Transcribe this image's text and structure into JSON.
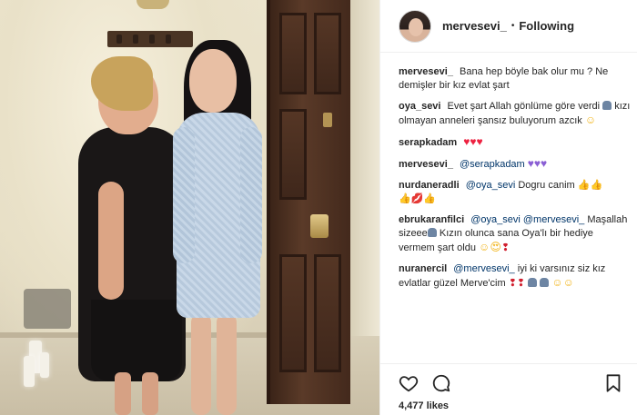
{
  "post": {
    "username": "mervesevi_",
    "follow_separator": "•",
    "follow_status": "Following",
    "likes_text": "4,477 likes"
  },
  "comments": {
    "c1": {
      "user": "mervesevi_",
      "text": "Bana hep böyle bak olur mu ? Ne demişler bir kız evlat şart"
    },
    "c2": {
      "user": "oya_sevi",
      "text1": "Evet şart Allah gönlüme göre verdi",
      "text2": "kızı olmayan anneleri şansız buluyorum azcık"
    },
    "c3": {
      "user": "serapkadam"
    },
    "c4": {
      "user": "mervesevi_",
      "mention": "@serapkadam"
    },
    "c5": {
      "user": "nurdaneradli",
      "mention": "@oya_sevi",
      "text": "Dogru canim"
    },
    "c6": {
      "user": "ebrukaranfilci",
      "mention1": "@oya_sevi",
      "mention2": "@mervesevi_",
      "text1": "Maşallah sizeee",
      "text2": "Kızın olunca sana Oya'lı bir hediye vermem şart oldu"
    },
    "c7": {
      "user": "nuranercil",
      "mention": "@mervesevi_",
      "text": "iyi ki varsınız siz kız evlatlar güzel Merve'cim"
    }
  },
  "icons": {
    "avatar": "profile-photo",
    "like": "heart-outline-icon",
    "comment": "speech-bubble-icon",
    "save": "bookmark-icon"
  },
  "colors": {
    "text": "#262626",
    "mention": "#003569",
    "divider": "#efefef"
  }
}
